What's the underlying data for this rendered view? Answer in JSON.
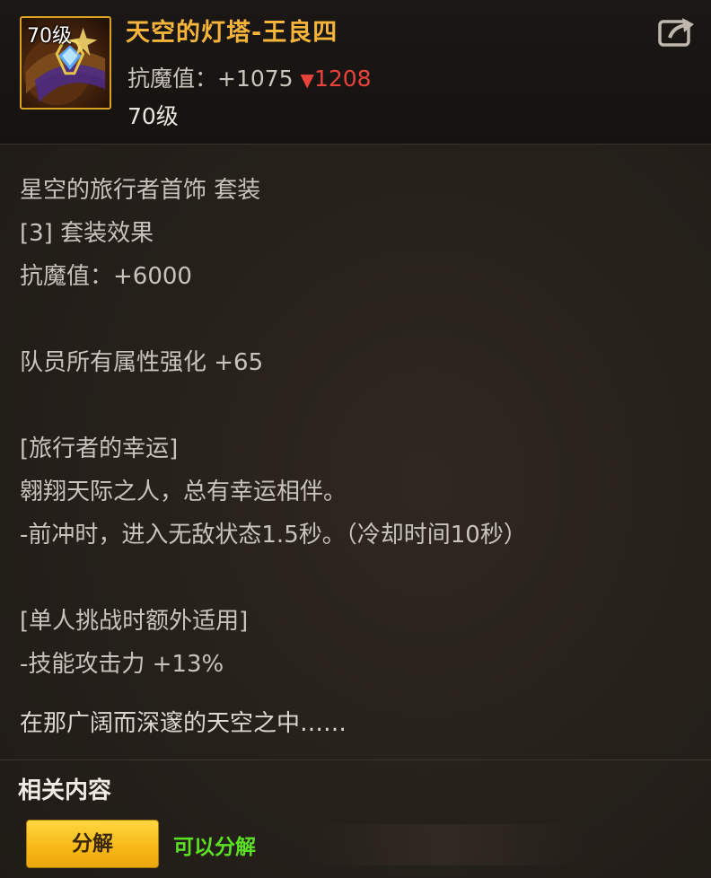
{
  "item": {
    "level_tag": "70级",
    "name": "天空的灯塔-王良四",
    "stat_label": "抗魔值：",
    "stat_value": "+1075",
    "stat_diff_arrow": "▼",
    "stat_diff": "1208",
    "level": "70级",
    "icon": "amulet-icon"
  },
  "set": {
    "name": "星空的旅行者首饰 套装",
    "effect_header": "[3] 套装效果",
    "bonus_stat": "抗魔值：+6000",
    "party_bonus": "队员所有属性强化 +65",
    "skill_title": "[旅行者的幸运]",
    "skill_desc": "翱翔天际之人，总有幸运相伴。",
    "skill_effect": "-前冲时，进入无敌状态1.5秒。（冷却时间10秒）",
    "solo_title": "[单人挑战时额外适用]",
    "solo_effect": "-技能攻击力 +13%"
  },
  "flavor_text": "在那广阔而深邃的天空之中……",
  "related": {
    "title": "相关内容",
    "decompose_label": "分解",
    "decompose_status": "可以分解"
  },
  "colors": {
    "name": "#f6b43a",
    "diff": "#e8423a",
    "status": "#5ce024",
    "button": "#f7b716"
  }
}
